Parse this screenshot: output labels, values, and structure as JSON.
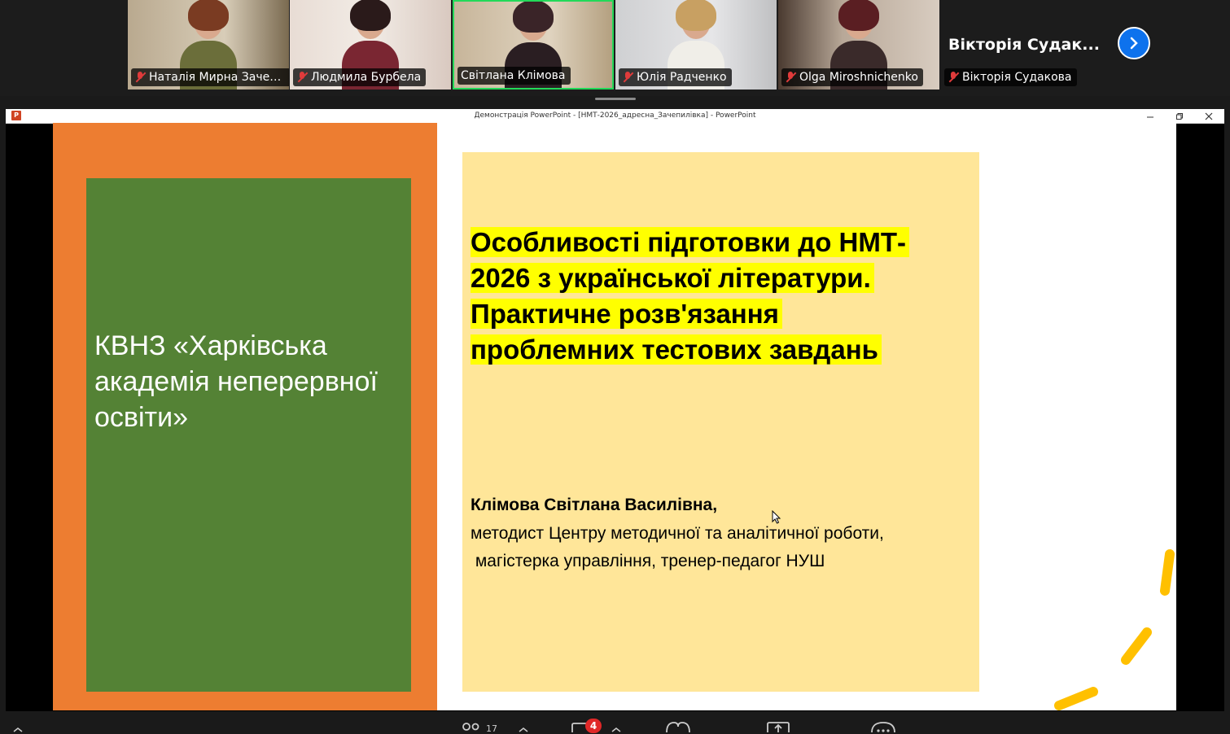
{
  "gallery": {
    "tiles": [
      {
        "name": "Наталія Мирна Зачеп...",
        "muted": true,
        "active": false
      },
      {
        "name": "Людмила Бурбела",
        "muted": true,
        "active": false
      },
      {
        "name": "Світлана Клімова",
        "muted": false,
        "active": true
      },
      {
        "name": "Юлія Радченко",
        "muted": true,
        "active": false
      },
      {
        "name": "Olga Miroshnichenko",
        "muted": true,
        "active": false
      },
      {
        "name": "Вікторія Судакова",
        "muted": true,
        "active": false
      }
    ],
    "big_name": "Вікторія Судак..."
  },
  "window": {
    "title": "Демонстрація PowerPoint - [НМТ-2026_адресна_Зачепилівка] - PowerPoint",
    "app_icon_text": "P"
  },
  "slide": {
    "org_name": "КВНЗ «Харківська академія неперервної освіти»",
    "title_lines": [
      "Особливості підготовки до НМТ-",
      "2026 з української літератури. ",
      "Практичне розв'язання ",
      "проблемних тестових завдань"
    ],
    "author_name": "Клімова Світлана Василівна,",
    "author_role": "методист Центру методичної та аналітичної роботи,",
    "author_degree": " магістерка управління, тренер-педагог НУШ",
    "colors": {
      "orange": "#ed7d31",
      "green": "#548235",
      "yellow_box": "#ffe699",
      "highlight": "#ffff00",
      "accent_dash": "#ffc000"
    }
  },
  "toolbar": {
    "participants_count": "17",
    "chat_badge": "4"
  },
  "icons": [
    "mic-muted-icon",
    "chevron-right-icon",
    "powerpoint-icon",
    "minimize-icon",
    "restore-icon",
    "close-icon",
    "participants-icon",
    "chat-icon",
    "reactions-icon",
    "share-screen-icon",
    "more-icon"
  ]
}
